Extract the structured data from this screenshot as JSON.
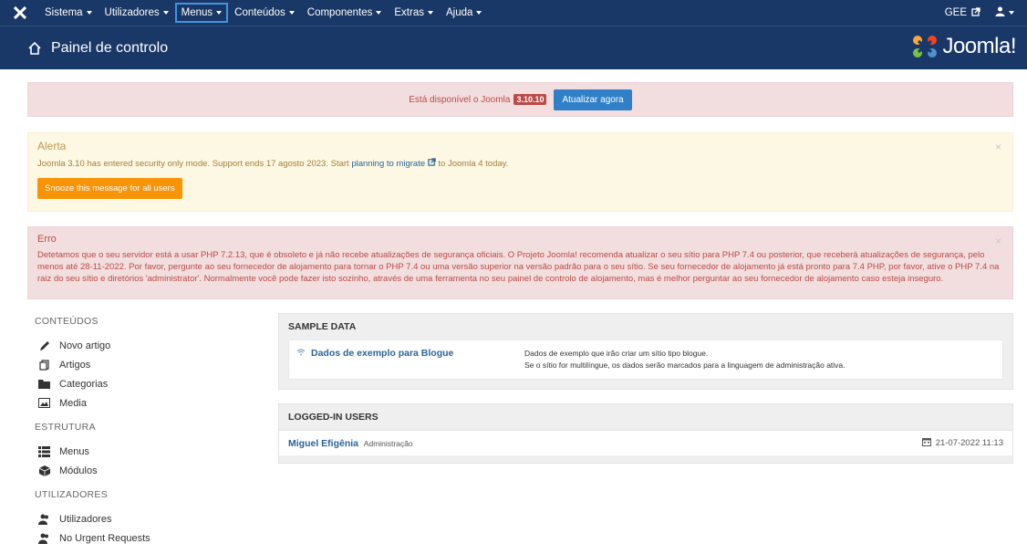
{
  "topnav": {
    "menus": [
      "Sistema",
      "Utilizadores",
      "Menus",
      "Conteúdos",
      "Componentes",
      "Extras",
      "Ajuda"
    ],
    "site_label": "GEE"
  },
  "header": {
    "title": "Painel de controlo",
    "brand": "Joomla!"
  },
  "update": {
    "text": "Está disponível o Joomla",
    "version": "3.10.10",
    "button": "Atualizar agora"
  },
  "warning": {
    "title": "Alerta",
    "text_before": "Joomla 3.10 has entered security only mode. Support ends 17 agosto 2023. Start",
    "link": "planning to migrate",
    "text_after": "to Joomla 4 today.",
    "button": "Snooze this message for all users",
    "close": "×"
  },
  "error": {
    "title": "Erro",
    "text": "Detetamos que o seu servidor está a usar PHP 7.2.13, que é obsoleto e já não recebe atualizações de segurança oficiais. O Projeto Joomla! recomenda atualizar o seu sítio para PHP 7.4 ou posterior, que receberá atualizações de segurança, pelo menos até 28-11-2022. Por favor, pergunte ao seu fornecedor de alojamento para tornar o PHP 7.4 ou uma versão superior na versão padrão para o seu sítio. Se seu fornecedor de alojamento já está pronto para 7.4 PHP, por favor, ative o PHP 7.4 na raiz do seu sítio e diretórios 'administrator'. Normalmente você pode fazer isto sozinho, através de uma ferramenta no seu painel de controlo de alojamento, mas é melhor perguntar ao seu fornecedor de alojamento caso esteja inseguro.",
    "close": "×"
  },
  "sidebar": {
    "sections": [
      {
        "title": "CONTEÚDOS",
        "items": [
          "Novo artigo",
          "Artigos",
          "Categorias",
          "Media"
        ]
      },
      {
        "title": "ESTRUTURA",
        "items": [
          "Menus",
          "Módulos"
        ]
      },
      {
        "title": "UTILIZADORES",
        "items": [
          "Utilizadores",
          "No Urgent Requests"
        ]
      }
    ]
  },
  "sample_data": {
    "title": "SAMPLE DATA",
    "link": "Dados de exemplo para Blogue",
    "desc_line1": "Dados de exemplo que irão criar um sítio tipo blogue.",
    "desc_line2": "Se o sítio for multilíngue, os dados serão marcados para a linguagem de administração ativa."
  },
  "logged_users": {
    "title": "LOGGED-IN USERS",
    "name": "Miguel Efigênia",
    "role": "Administração",
    "date": "21-07-2022 11:13"
  }
}
